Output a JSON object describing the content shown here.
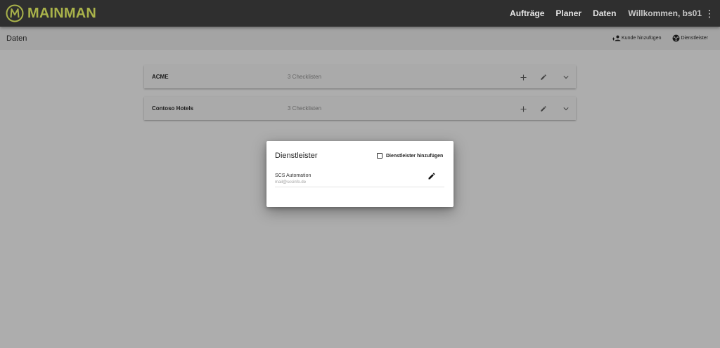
{
  "app": {
    "name": "MAINMAN",
    "brand_color": "#a9b24a"
  },
  "nav": {
    "items": [
      "Aufträge",
      "Planer",
      "Daten"
    ],
    "user": "Willkommen, bs01",
    "menu_icon": "kebab-menu-icon"
  },
  "subbar": {
    "title": "Daten",
    "actions": [
      {
        "label": "Kunde hinzufügen",
        "icon": "person-add-icon"
      },
      {
        "label": "Dienstleister",
        "icon": "provider-icon"
      }
    ]
  },
  "customers": [
    {
      "name": "ACME",
      "checklists": "3 Checklisten"
    },
    {
      "name": "Contoso Hotels",
      "checklists": "3 Checklisten"
    }
  ],
  "dialog": {
    "title": "Dienstleister",
    "add_label": "Dienstleister hinzufügen",
    "providers": [
      {
        "name": "SCS Automation",
        "email": "mail@scsinfo.de"
      }
    ]
  }
}
